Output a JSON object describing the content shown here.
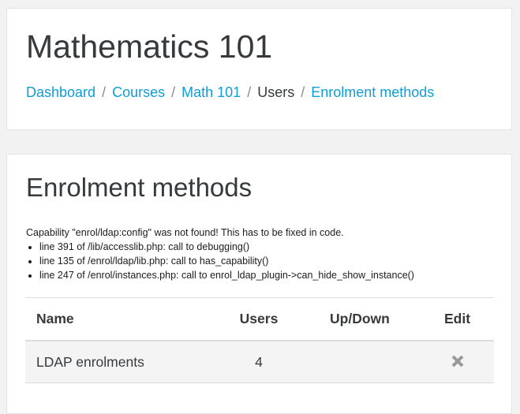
{
  "header": {
    "title": "Mathematics 101",
    "breadcrumb": [
      {
        "label": "Dashboard",
        "link": true
      },
      {
        "label": "Courses",
        "link": true
      },
      {
        "label": "Math 101",
        "link": true
      },
      {
        "label": "Users",
        "link": false
      },
      {
        "label": "Enrolment methods",
        "link": true
      }
    ],
    "separator": "/"
  },
  "main": {
    "title": "Enrolment methods",
    "debug": {
      "message": "Capability \"enrol/ldap:config\" was not found! This has to be fixed in code.",
      "lines": [
        "line 391 of /lib/accesslib.php: call to debugging()",
        "line 135 of /enrol/ldap/lib.php: call to has_capability()",
        "line 247 of /enrol/instances.php: call to enrol_ldap_plugin->can_hide_show_instance()"
      ]
    },
    "table": {
      "headers": {
        "name": "Name",
        "users": "Users",
        "updown": "Up/Down",
        "edit": "Edit"
      },
      "rows": [
        {
          "name": "LDAP enrolments",
          "users": "4",
          "edit_icon": "delete-x-icon"
        }
      ]
    }
  },
  "colors": {
    "link": "#0f9dd5",
    "text": "#373a3c",
    "background": "#f2f2f2",
    "icon": "#999999"
  }
}
